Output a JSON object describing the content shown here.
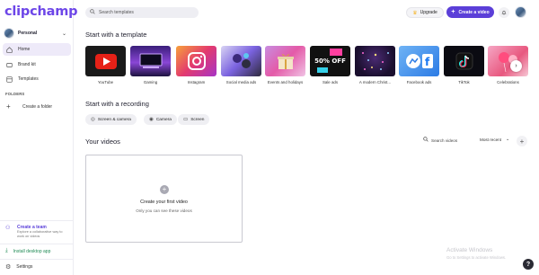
{
  "app": {
    "logo": "clipchamp"
  },
  "sidebar": {
    "profile_name": "Personal",
    "nav": [
      {
        "label": "Home",
        "icon": "home-icon"
      },
      {
        "label": "Brand kit",
        "icon": "brand-kit-icon"
      },
      {
        "label": "Templates",
        "icon": "templates-icon"
      }
    ],
    "folders_heading": "FOLDERS",
    "create_folder": "Create a folder",
    "team": {
      "title": "Create a team",
      "description": "Explore a collaborative way to work on videos"
    },
    "install": "Install desktop app",
    "settings": "Settings"
  },
  "topbar": {
    "search_placeholder": "Search templates",
    "upgrade": "Upgrade",
    "create_video": "Create a video"
  },
  "templates": {
    "title": "Start with a template",
    "items": [
      {
        "label": "YouTube"
      },
      {
        "label": "Gaming"
      },
      {
        "label": "Instagram"
      },
      {
        "label": "Social media ads"
      },
      {
        "label": "Events and holidays"
      },
      {
        "label": "Sale ads",
        "thumb_text": "50% OFF"
      },
      {
        "label": "A modern Christ..."
      },
      {
        "label": "Facebook ads"
      },
      {
        "label": "TikTok"
      },
      {
        "label": "Celebrations"
      }
    ]
  },
  "recording": {
    "title": "Start with a recording",
    "buttons": [
      {
        "label": "Screen & camera"
      },
      {
        "label": "Camera"
      },
      {
        "label": "Screen"
      }
    ]
  },
  "videos": {
    "title": "Your videos",
    "search": "Search videos",
    "sort": "Most recent",
    "empty_title": "Create your first video",
    "empty_subtitle": "Only you can see these videos"
  },
  "watermark": {
    "title": "Activate Windows",
    "subtitle": "Go to Settings to activate Windows."
  },
  "help": "?",
  "colors": {
    "accent": "#5b3fd8",
    "logo": "#6d46e8",
    "install": "#1f8a54"
  }
}
